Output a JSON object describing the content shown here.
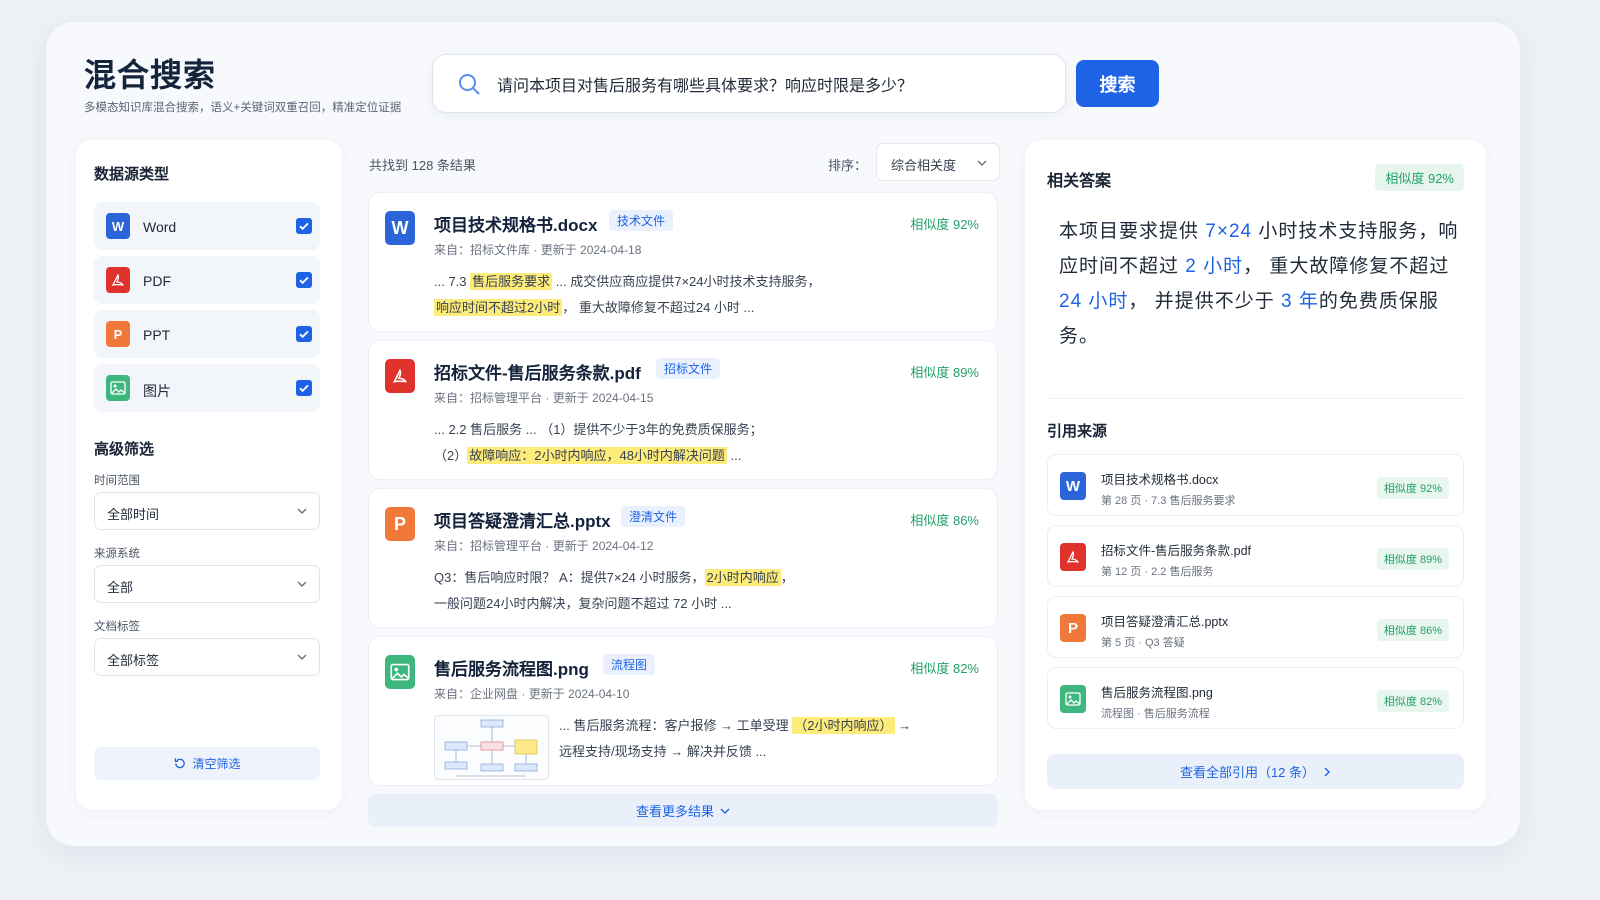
{
  "header": {
    "title": "混合搜索",
    "subtitle": "多模态知识库混合搜索，语义+关键词双重召回，精准定位证据"
  },
  "search": {
    "query": "请问本项目对售后服务有哪些具体要求？响应时限是多少？",
    "button_label": "搜索"
  },
  "filters": {
    "source_title": "数据源类型",
    "sources": [
      {
        "label": "Word",
        "icon": "word-icon",
        "checked": true
      },
      {
        "label": "PDF",
        "icon": "pdf-icon",
        "checked": true
      },
      {
        "label": "PPT",
        "icon": "ppt-icon",
        "checked": true
      },
      {
        "label": "图片",
        "icon": "image-icon",
        "checked": true
      }
    ],
    "advanced_title": "高级筛选",
    "time_label": "时间范围",
    "time_value": "全部时间",
    "system_label": "来源系统",
    "system_value": "全部",
    "tag_label": "文档标签",
    "tag_value": "全部标签",
    "clear_label": "清空筛选"
  },
  "results": {
    "count_text": "共找到 128 条结果",
    "sort_label": "排序：",
    "sort_value": "综合相关度",
    "items": [
      {
        "title": "项目技术规格书.docx",
        "tag": "技术文件",
        "similarity": "相似度 92%",
        "source": "来自：招标文件库",
        "updated": "更新于 2024-04-18",
        "l1a": "... 7.3 ",
        "l1h": "售后服务要求",
        "l1b": " ...    成交供应商应提供7×24小时技术支持服务，",
        "l2h": "响应时间不超过2小时",
        "l2b": "，  重大故障修复不超过24 小时 ..."
      },
      {
        "title": "招标文件-售后服务条款.pdf",
        "tag": "招标文件",
        "similarity": "相似度 89%",
        "source": "来自：招标管理平台",
        "updated": "更新于 2024-04-15",
        "l1a": "... 2.2 售后服务 ...  （1）提供不少于3年的免费质保服务；",
        "l2a": "（2）",
        "l2h": "故障响应：2小时内响应，48小时内解决问题",
        "l2b": " ..."
      },
      {
        "title": "项目答疑澄清汇总.pptx",
        "tag": "澄清文件",
        "similarity": "相似度 86%",
        "source": "来自：招标管理平台",
        "updated": "更新于 2024-04-12",
        "l1a": "Q3：售后响应时限？  A：提供7×24 小时服务，",
        "l1h": "2小时内响应",
        "l1b": "，",
        "l2a": "一般问题24小时内解决，复杂问题不超过 72 小时 ..."
      },
      {
        "title": "售后服务流程图.png",
        "tag": "流程图",
        "similarity": "相似度 82%",
        "source": "来自：企业网盘",
        "updated": "更新于 2024-04-10",
        "l1a": "... 售后服务流程：客户报修 → 工单受理 ",
        "l1h": "（2小时内响应）",
        "l1b": " →",
        "l2a": "远程支持/现场支持 → 解决并反馈 ..."
      }
    ],
    "more_label": "查看更多结果"
  },
  "answer": {
    "title": "相关答案",
    "similarity": "相似度 92%",
    "t1": "本项目要求提供 ",
    "b1": "7×24",
    "t2": " 小时技术支持服务，响应时间不超过 ",
    "b2": "2 小时",
    "t3": "，  重大故障修复不超过 ",
    "b3": "24 小时",
    "t4": "，  并提供不少于 ",
    "b4": "3 年",
    "t5": "的免费质保服务。",
    "cite_title": "引用来源",
    "citations": [
      {
        "name": "项目技术规格书.docx",
        "sub": "第 28 页  ·  7.3 售后服务要求",
        "sim": "相似度 92%"
      },
      {
        "name": "招标文件-售后服务条款.pdf",
        "sub": "第 12 页  ·  2.2 售后服务",
        "sim": "相似度 89%"
      },
      {
        "name": "项目答疑澄清汇总.pptx",
        "sub": "第 5 页  ·  Q3 答疑",
        "sim": "相似度 86%"
      },
      {
        "name": "售后服务流程图.png",
        "sub": "流程图  ·  售后服务流程",
        "sim": "相似度 82%"
      }
    ],
    "all_cite_label": "查看全部引用（12 条）"
  },
  "colors": {
    "accent": "#1e63e6",
    "similarity_green": "#22a06b",
    "highlight": "#fdeb7a"
  }
}
